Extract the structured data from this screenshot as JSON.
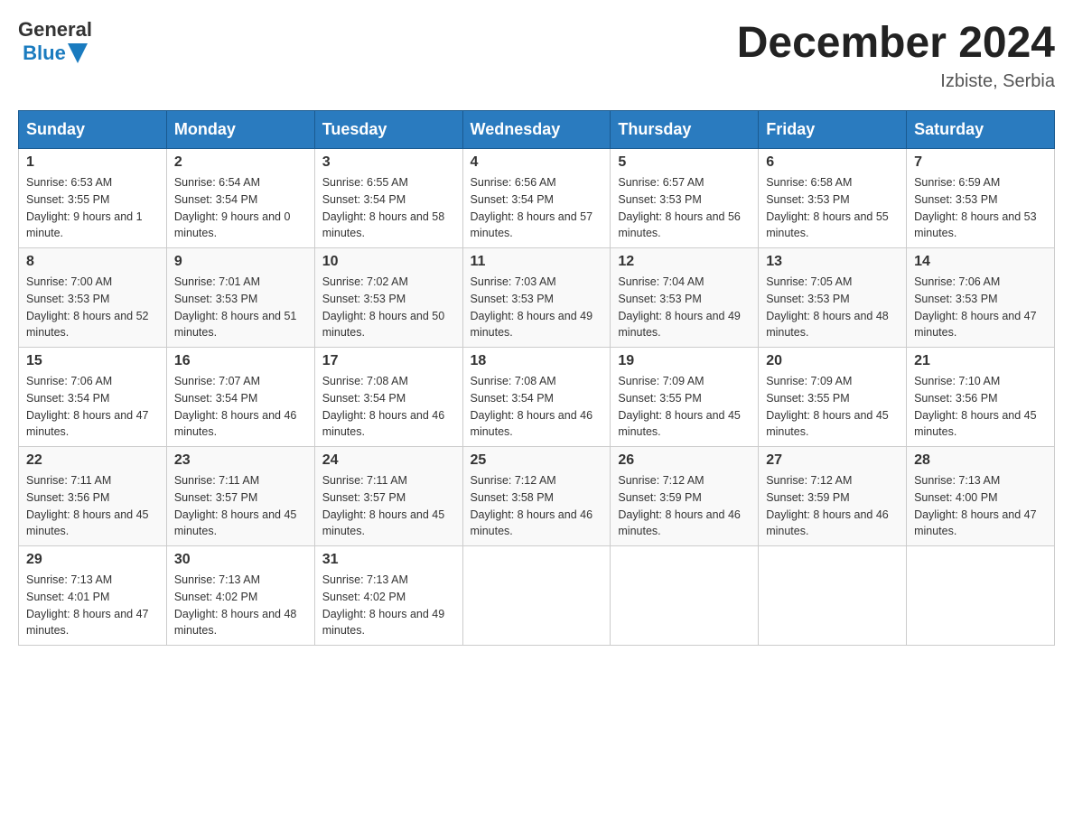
{
  "header": {
    "month_title": "December 2024",
    "location": "Izbiste, Serbia"
  },
  "days_of_week": [
    "Sunday",
    "Monday",
    "Tuesday",
    "Wednesday",
    "Thursday",
    "Friday",
    "Saturday"
  ],
  "weeks": [
    [
      {
        "day": "1",
        "sunrise": "6:53 AM",
        "sunset": "3:55 PM",
        "daylight": "9 hours and 1 minute."
      },
      {
        "day": "2",
        "sunrise": "6:54 AM",
        "sunset": "3:54 PM",
        "daylight": "9 hours and 0 minutes."
      },
      {
        "day": "3",
        "sunrise": "6:55 AM",
        "sunset": "3:54 PM",
        "daylight": "8 hours and 58 minutes."
      },
      {
        "day": "4",
        "sunrise": "6:56 AM",
        "sunset": "3:54 PM",
        "daylight": "8 hours and 57 minutes."
      },
      {
        "day": "5",
        "sunrise": "6:57 AM",
        "sunset": "3:53 PM",
        "daylight": "8 hours and 56 minutes."
      },
      {
        "day": "6",
        "sunrise": "6:58 AM",
        "sunset": "3:53 PM",
        "daylight": "8 hours and 55 minutes."
      },
      {
        "day": "7",
        "sunrise": "6:59 AM",
        "sunset": "3:53 PM",
        "daylight": "8 hours and 53 minutes."
      }
    ],
    [
      {
        "day": "8",
        "sunrise": "7:00 AM",
        "sunset": "3:53 PM",
        "daylight": "8 hours and 52 minutes."
      },
      {
        "day": "9",
        "sunrise": "7:01 AM",
        "sunset": "3:53 PM",
        "daylight": "8 hours and 51 minutes."
      },
      {
        "day": "10",
        "sunrise": "7:02 AM",
        "sunset": "3:53 PM",
        "daylight": "8 hours and 50 minutes."
      },
      {
        "day": "11",
        "sunrise": "7:03 AM",
        "sunset": "3:53 PM",
        "daylight": "8 hours and 49 minutes."
      },
      {
        "day": "12",
        "sunrise": "7:04 AM",
        "sunset": "3:53 PM",
        "daylight": "8 hours and 49 minutes."
      },
      {
        "day": "13",
        "sunrise": "7:05 AM",
        "sunset": "3:53 PM",
        "daylight": "8 hours and 48 minutes."
      },
      {
        "day": "14",
        "sunrise": "7:06 AM",
        "sunset": "3:53 PM",
        "daylight": "8 hours and 47 minutes."
      }
    ],
    [
      {
        "day": "15",
        "sunrise": "7:06 AM",
        "sunset": "3:54 PM",
        "daylight": "8 hours and 47 minutes."
      },
      {
        "day": "16",
        "sunrise": "7:07 AM",
        "sunset": "3:54 PM",
        "daylight": "8 hours and 46 minutes."
      },
      {
        "day": "17",
        "sunrise": "7:08 AM",
        "sunset": "3:54 PM",
        "daylight": "8 hours and 46 minutes."
      },
      {
        "day": "18",
        "sunrise": "7:08 AM",
        "sunset": "3:54 PM",
        "daylight": "8 hours and 46 minutes."
      },
      {
        "day": "19",
        "sunrise": "7:09 AM",
        "sunset": "3:55 PM",
        "daylight": "8 hours and 45 minutes."
      },
      {
        "day": "20",
        "sunrise": "7:09 AM",
        "sunset": "3:55 PM",
        "daylight": "8 hours and 45 minutes."
      },
      {
        "day": "21",
        "sunrise": "7:10 AM",
        "sunset": "3:56 PM",
        "daylight": "8 hours and 45 minutes."
      }
    ],
    [
      {
        "day": "22",
        "sunrise": "7:11 AM",
        "sunset": "3:56 PM",
        "daylight": "8 hours and 45 minutes."
      },
      {
        "day": "23",
        "sunrise": "7:11 AM",
        "sunset": "3:57 PM",
        "daylight": "8 hours and 45 minutes."
      },
      {
        "day": "24",
        "sunrise": "7:11 AM",
        "sunset": "3:57 PM",
        "daylight": "8 hours and 45 minutes."
      },
      {
        "day": "25",
        "sunrise": "7:12 AM",
        "sunset": "3:58 PM",
        "daylight": "8 hours and 46 minutes."
      },
      {
        "day": "26",
        "sunrise": "7:12 AM",
        "sunset": "3:59 PM",
        "daylight": "8 hours and 46 minutes."
      },
      {
        "day": "27",
        "sunrise": "7:12 AM",
        "sunset": "3:59 PM",
        "daylight": "8 hours and 46 minutes."
      },
      {
        "day": "28",
        "sunrise": "7:13 AM",
        "sunset": "4:00 PM",
        "daylight": "8 hours and 47 minutes."
      }
    ],
    [
      {
        "day": "29",
        "sunrise": "7:13 AM",
        "sunset": "4:01 PM",
        "daylight": "8 hours and 47 minutes."
      },
      {
        "day": "30",
        "sunrise": "7:13 AM",
        "sunset": "4:02 PM",
        "daylight": "8 hours and 48 minutes."
      },
      {
        "day": "31",
        "sunrise": "7:13 AM",
        "sunset": "4:02 PM",
        "daylight": "8 hours and 49 minutes."
      },
      null,
      null,
      null,
      null
    ]
  ]
}
